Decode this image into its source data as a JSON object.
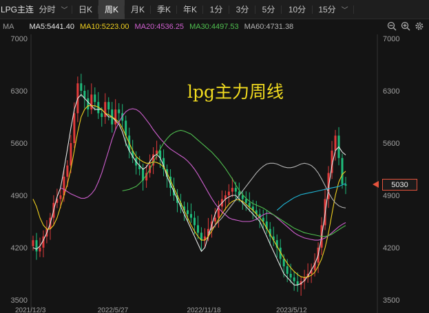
{
  "tabs": [
    {
      "label": "LPG主连",
      "active": false
    },
    {
      "label": "分时",
      "active": false,
      "chevron": "chevron-down-icon"
    },
    {
      "label": "日K",
      "active": false
    },
    {
      "label": "周K",
      "active": true
    },
    {
      "label": "月K",
      "active": false
    },
    {
      "label": "季K",
      "active": false
    },
    {
      "label": "年K",
      "active": false
    },
    {
      "label": "1分",
      "active": false
    },
    {
      "label": "3分",
      "active": false
    },
    {
      "label": "5分",
      "active": false
    },
    {
      "label": "10分",
      "active": false
    },
    {
      "label": "15分",
      "active": false,
      "chevron": "chevron-down-icon"
    }
  ],
  "ma_bar": {
    "label": "MA",
    "items": [
      {
        "text": "MA5:5441.40",
        "color": "#e8e8e8"
      },
      {
        "text": "MA10:5223.00",
        "color": "#f0d020"
      },
      {
        "text": "MA20:4536.25",
        "color": "#d060d0"
      },
      {
        "text": "MA30:4497.53",
        "color": "#50c050"
      },
      {
        "text": "MA60:4731.38",
        "color": "#b4b4b4"
      }
    ],
    "tools": [
      "zoom-out-icon",
      "zoom-in-icon",
      "settings-gear-icon"
    ]
  },
  "overlay_title": "lpg主力周线",
  "current_price": "5030",
  "colors": {
    "up": "#e23b3b",
    "down": "#1fbd7c",
    "ma5": "#e8e8e8",
    "ma10": "#f0d020",
    "ma20": "#d060d0",
    "ma30": "#50c050",
    "ma60": "#b4b4b4",
    "ma120": "#20b8d8",
    "accent": "#e5533d"
  },
  "chart_data": {
    "type": "candlestick",
    "period": "weekly",
    "ylim": [
      3500,
      7000
    ],
    "y_ticks": [
      "7000",
      "6300",
      "5600",
      "4900",
      "4200",
      "3500"
    ],
    "x_ticks": [
      "2021/12/3",
      "2022/5/27",
      "2022/11/18",
      "2023/5/12"
    ],
    "grid": false,
    "close": [
      4300,
      4150,
      4200,
      4350,
      4450,
      4600,
      4800,
      4850,
      4900,
      5150,
      5300,
      5600,
      6000,
      6400,
      6300,
      6200,
      6050,
      6250,
      6150,
      6000,
      5950,
      6150,
      6050,
      5850,
      6050,
      6000,
      5900,
      5700,
      5500,
      5400,
      5300,
      5250,
      5100,
      5200,
      5300,
      5450,
      5500,
      5400,
      5250,
      5150,
      5000,
      4900,
      4800,
      4750,
      4700,
      4650,
      4600,
      4500,
      4400,
      4300,
      4350,
      4450,
      4550,
      4600,
      4750,
      4850,
      4900,
      4950,
      5000,
      4950,
      4900,
      4850,
      4800,
      4750,
      4700,
      4650,
      4600,
      4550,
      4450,
      4350,
      4300,
      4200,
      4050,
      3950,
      3850,
      3800,
      3750,
      3700,
      3750,
      3800,
      3850,
      3900,
      4000,
      4200,
      4500,
      4850,
      5200,
      5500,
      5700,
      5400,
      5050,
      5030
    ],
    "series": [
      {
        "name": "MA5",
        "values": [
          4200,
          4180,
          4220,
          4300,
          4400,
          4520,
          4700,
          4880,
          5000,
          5250,
          5520,
          5800,
          6050,
          6200,
          6250,
          6200,
          6150,
          6100,
          6050,
          6050,
          6050,
          6000,
          5950,
          5950,
          5900,
          5850,
          5750,
          5600,
          5500,
          5420,
          5350,
          5300,
          5250,
          5280,
          5350,
          5420,
          5450,
          5400,
          5300,
          5150,
          5050,
          4950,
          4850,
          4750,
          4650,
          4550,
          4450,
          4350,
          4250,
          4150,
          4200,
          4350,
          4500,
          4650,
          4750,
          4800,
          4850,
          4880,
          4900,
          4900,
          4850,
          4800,
          4750,
          4700,
          4650,
          4600,
          4550,
          4450,
          4350,
          4250,
          4150,
          4050,
          3950,
          3850,
          3800,
          3750,
          3700,
          3700,
          3720,
          3760,
          3820,
          3900,
          3980,
          4100,
          4350,
          4650,
          5000,
          5300,
          5500,
          5550,
          5480,
          5441
        ]
      },
      {
        "name": "MA10",
        "values": [
          4850,
          4750,
          4600,
          4500,
          4450,
          4450,
          4500,
          4600,
          4750,
          4900,
          5050,
          5250,
          5500,
          5750,
          5950,
          6050,
          6100,
          6100,
          6100,
          6080,
          6050,
          6000,
          5980,
          5950,
          5920,
          5880,
          5800,
          5700,
          5600,
          5500,
          5420,
          5380,
          5350,
          5330,
          5330,
          5350,
          5340,
          5320,
          5280,
          5200,
          5100,
          5000,
          4900,
          4800,
          4700,
          4600,
          4500,
          4420,
          4350,
          4300,
          4300,
          4350,
          4420,
          4500,
          4580,
          4650,
          4720,
          4780,
          4820,
          4840,
          4840,
          4820,
          4780,
          4740,
          4700,
          4650,
          4600,
          4540,
          4460,
          4380,
          4300,
          4220,
          4140,
          4060,
          3990,
          3930,
          3880,
          3840,
          3810,
          3800,
          3810,
          3830,
          3870,
          3950,
          4050,
          4200,
          4400,
          4650,
          4900,
          5080,
          5180,
          5223
        ]
      },
      {
        "name": "MA20",
        "values": [
          5000,
          4980,
          4950,
          4920,
          4900,
          4880,
          4860,
          4860,
          4880,
          4920,
          4980,
          5080,
          5200,
          5350,
          5500,
          5650,
          5780,
          5880,
          5960,
          6020,
          6050,
          6060,
          6050,
          6020,
          5970,
          5910,
          5850,
          5780,
          5720,
          5660,
          5610,
          5560,
          5520,
          5490,
          5460,
          5430,
          5400,
          5360,
          5310,
          5250,
          5180,
          5100,
          5020,
          4940,
          4860,
          4790,
          4730,
          4680,
          4640,
          4600,
          4580,
          4570,
          4560,
          4550,
          4550,
          4550,
          4560,
          4580,
          4610,
          4640,
          4660,
          4660,
          4640,
          4600,
          4560,
          4520,
          4480,
          4440,
          4400,
          4370,
          4350,
          4330,
          4320,
          4310,
          4300,
          4300,
          4310,
          4330,
          4360,
          4400,
          4440,
          4480,
          4510,
          4536
        ]
      },
      {
        "name": "MA30",
        "values": [
          4960,
          4970,
          4980,
          5000,
          5020,
          5060,
          5110,
          5170,
          5250,
          5340,
          5430,
          5520,
          5600,
          5660,
          5710,
          5740,
          5760,
          5770,
          5760,
          5740,
          5720,
          5680,
          5640,
          5600,
          5560,
          5520,
          5480,
          5430,
          5380,
          5320,
          5260,
          5190,
          5120,
          5040,
          4970,
          4910,
          4860,
          4820,
          4790,
          4770,
          4750,
          4730,
          4700,
          4670,
          4640,
          4610,
          4580,
          4550,
          4520,
          4490,
          4460,
          4440,
          4420,
          4400,
          4390,
          4380,
          4370,
          4360,
          4350,
          4350,
          4360,
          4380,
          4410,
          4440,
          4470,
          4497
        ]
      },
      {
        "name": "MA60",
        "values": [
          4400,
          4450,
          4500,
          4550,
          4600,
          4660,
          4720,
          4780,
          4840,
          4900,
          4960,
          5020,
          5080,
          5140,
          5200,
          5250,
          5290,
          5320,
          5330,
          5330,
          5320,
          5300,
          5280,
          5270,
          5270,
          5280,
          5300,
          5320,
          5330,
          5320,
          5300,
          5260,
          5200,
          5120,
          5030,
          4940,
          4860,
          4800,
          4760,
          4740,
          4731
        ]
      },
      {
        "name": "MA120",
        "values": [
          4700,
          4740,
          4780,
          4810,
          4840,
          4870,
          4890,
          4910,
          4920,
          4930,
          4940,
          4950,
          4960,
          4970,
          4980,
          4990,
          5000,
          5010,
          5020,
          5040,
          5060
        ]
      }
    ]
  }
}
